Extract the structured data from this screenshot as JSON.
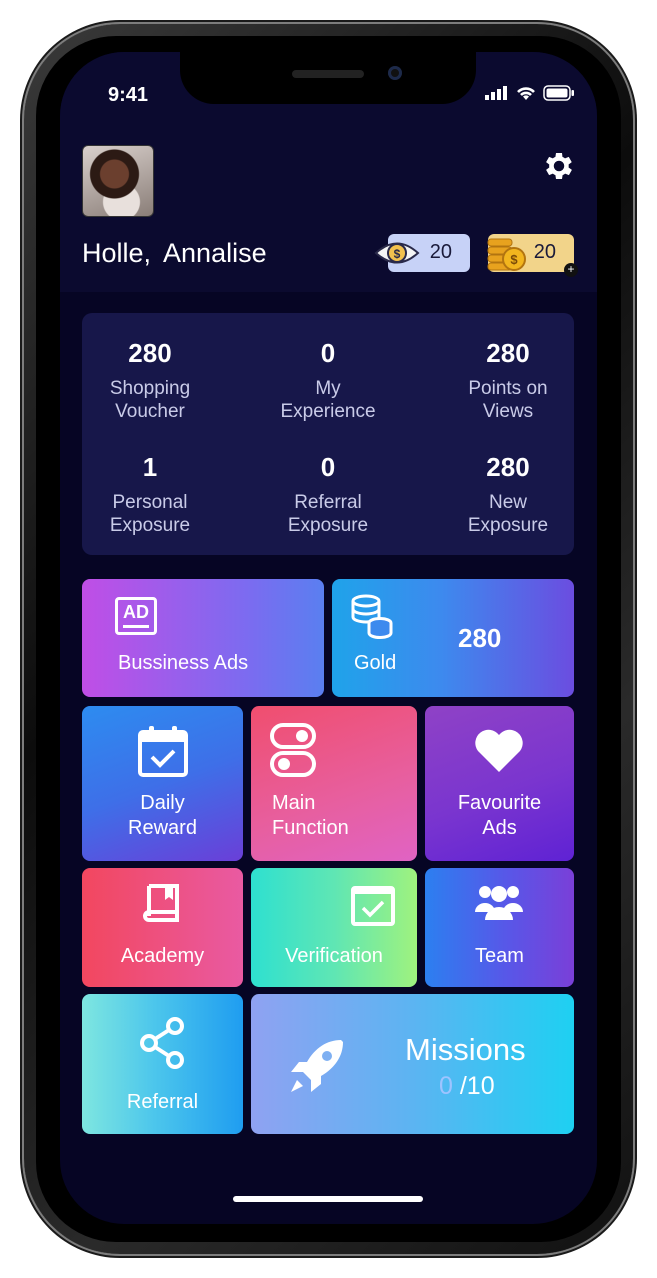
{
  "status_bar": {
    "time": "9:41"
  },
  "header": {
    "greeting": "Holle,",
    "name": "Annalise",
    "views_count": "20",
    "coins_count": "20"
  },
  "stats": [
    {
      "value": "280",
      "label_line1": "Shopping",
      "label_line2": "Voucher"
    },
    {
      "value": "0",
      "label_line1": "My",
      "label_line2": "Experience"
    },
    {
      "value": "280",
      "label_line1": "Points on",
      "label_line2": "Views"
    },
    {
      "value": "1",
      "label_line1": "Personal",
      "label_line2": "Exposure"
    },
    {
      "value": "0",
      "label_line1": "Referral",
      "label_line2": "Exposure"
    },
    {
      "value": "280",
      "label_line1": "New",
      "label_line2": "Exposure"
    }
  ],
  "tiles": {
    "business_ads": "Bussiness Ads",
    "gold_label": "Gold",
    "gold_value": "280",
    "daily_line1": "Daily",
    "daily_line2": "Reward",
    "main_line1": "Main",
    "main_line2": "Function",
    "fav_line1": "Favourite",
    "fav_line2": "Ads",
    "academy": "Academy",
    "verification": "Verification",
    "team": "Team",
    "referral": "Referral",
    "missions": "Missions",
    "missions_done": "0",
    "missions_total": "/10"
  },
  "icons": {
    "ad_badge_text": "AD"
  },
  "colors": {
    "screen_bg": "#060524",
    "card_bg": "#17174a"
  }
}
